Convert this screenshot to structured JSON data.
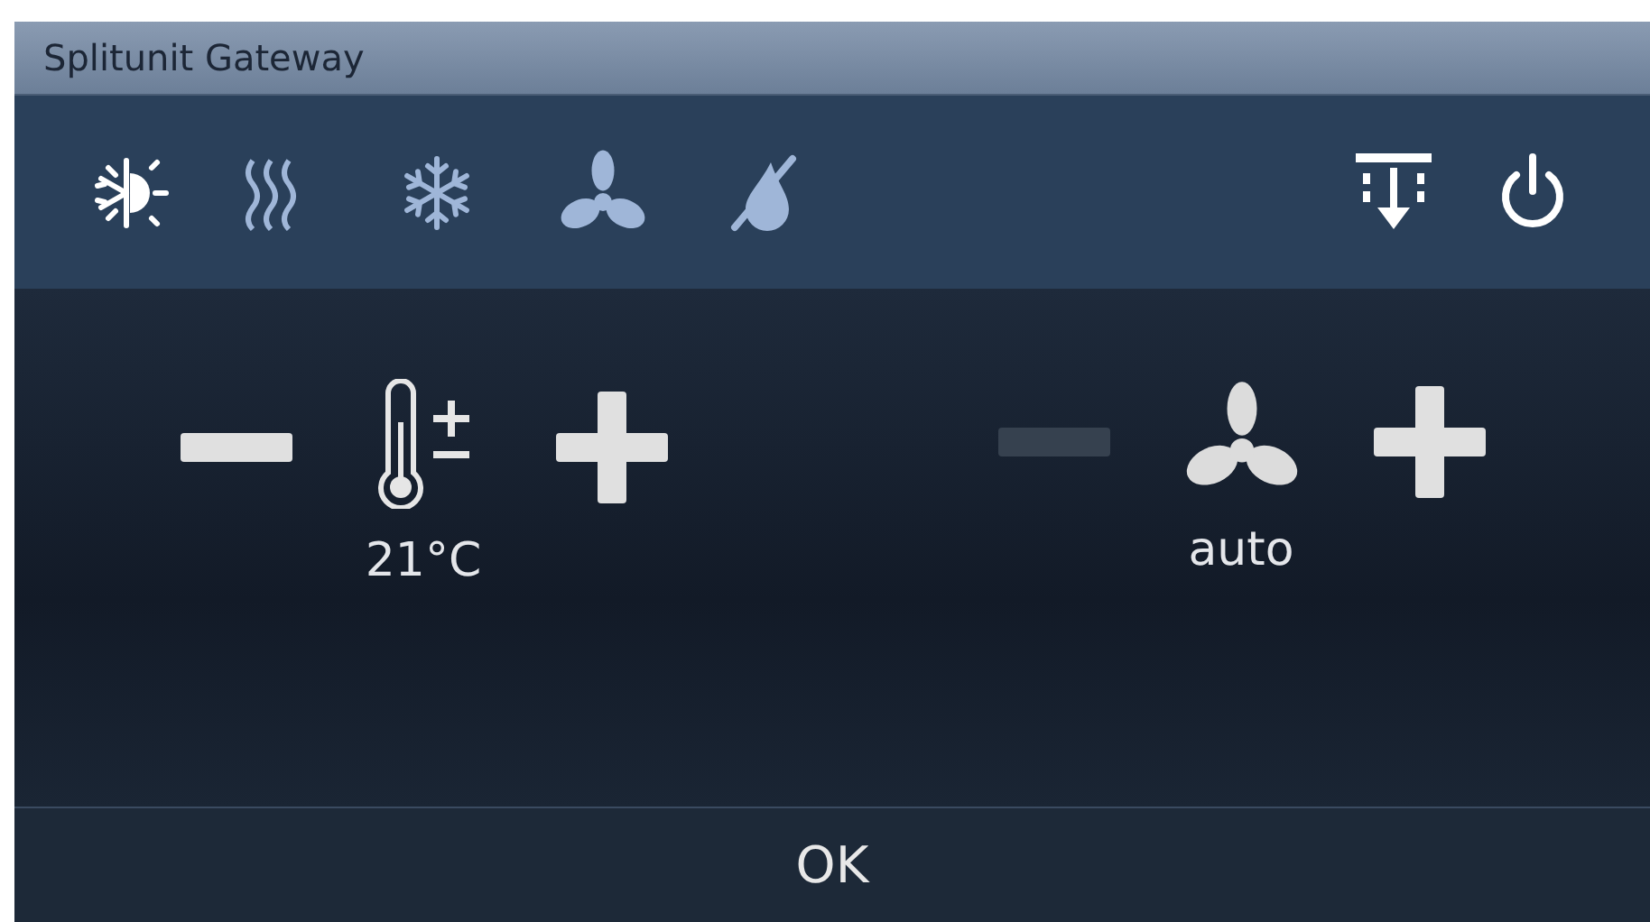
{
  "window": {
    "title": "Splitunit Gateway"
  },
  "modes": [
    {
      "kind": "auto",
      "selected": true
    },
    {
      "kind": "heat",
      "selected": false
    },
    {
      "kind": "cool",
      "selected": false
    },
    {
      "kind": "fan",
      "selected": false
    },
    {
      "kind": "dry",
      "selected": false
    }
  ],
  "actions": [
    {
      "kind": "louver"
    },
    {
      "kind": "power"
    }
  ],
  "controls": [
    {
      "kind": "temperature",
      "value": "21°C",
      "minus_disabled": false,
      "plus_disabled": false
    },
    {
      "kind": "fan",
      "value": "auto",
      "minus_disabled": true,
      "plus_disabled": false
    }
  ],
  "footer": {
    "button": "OK"
  }
}
